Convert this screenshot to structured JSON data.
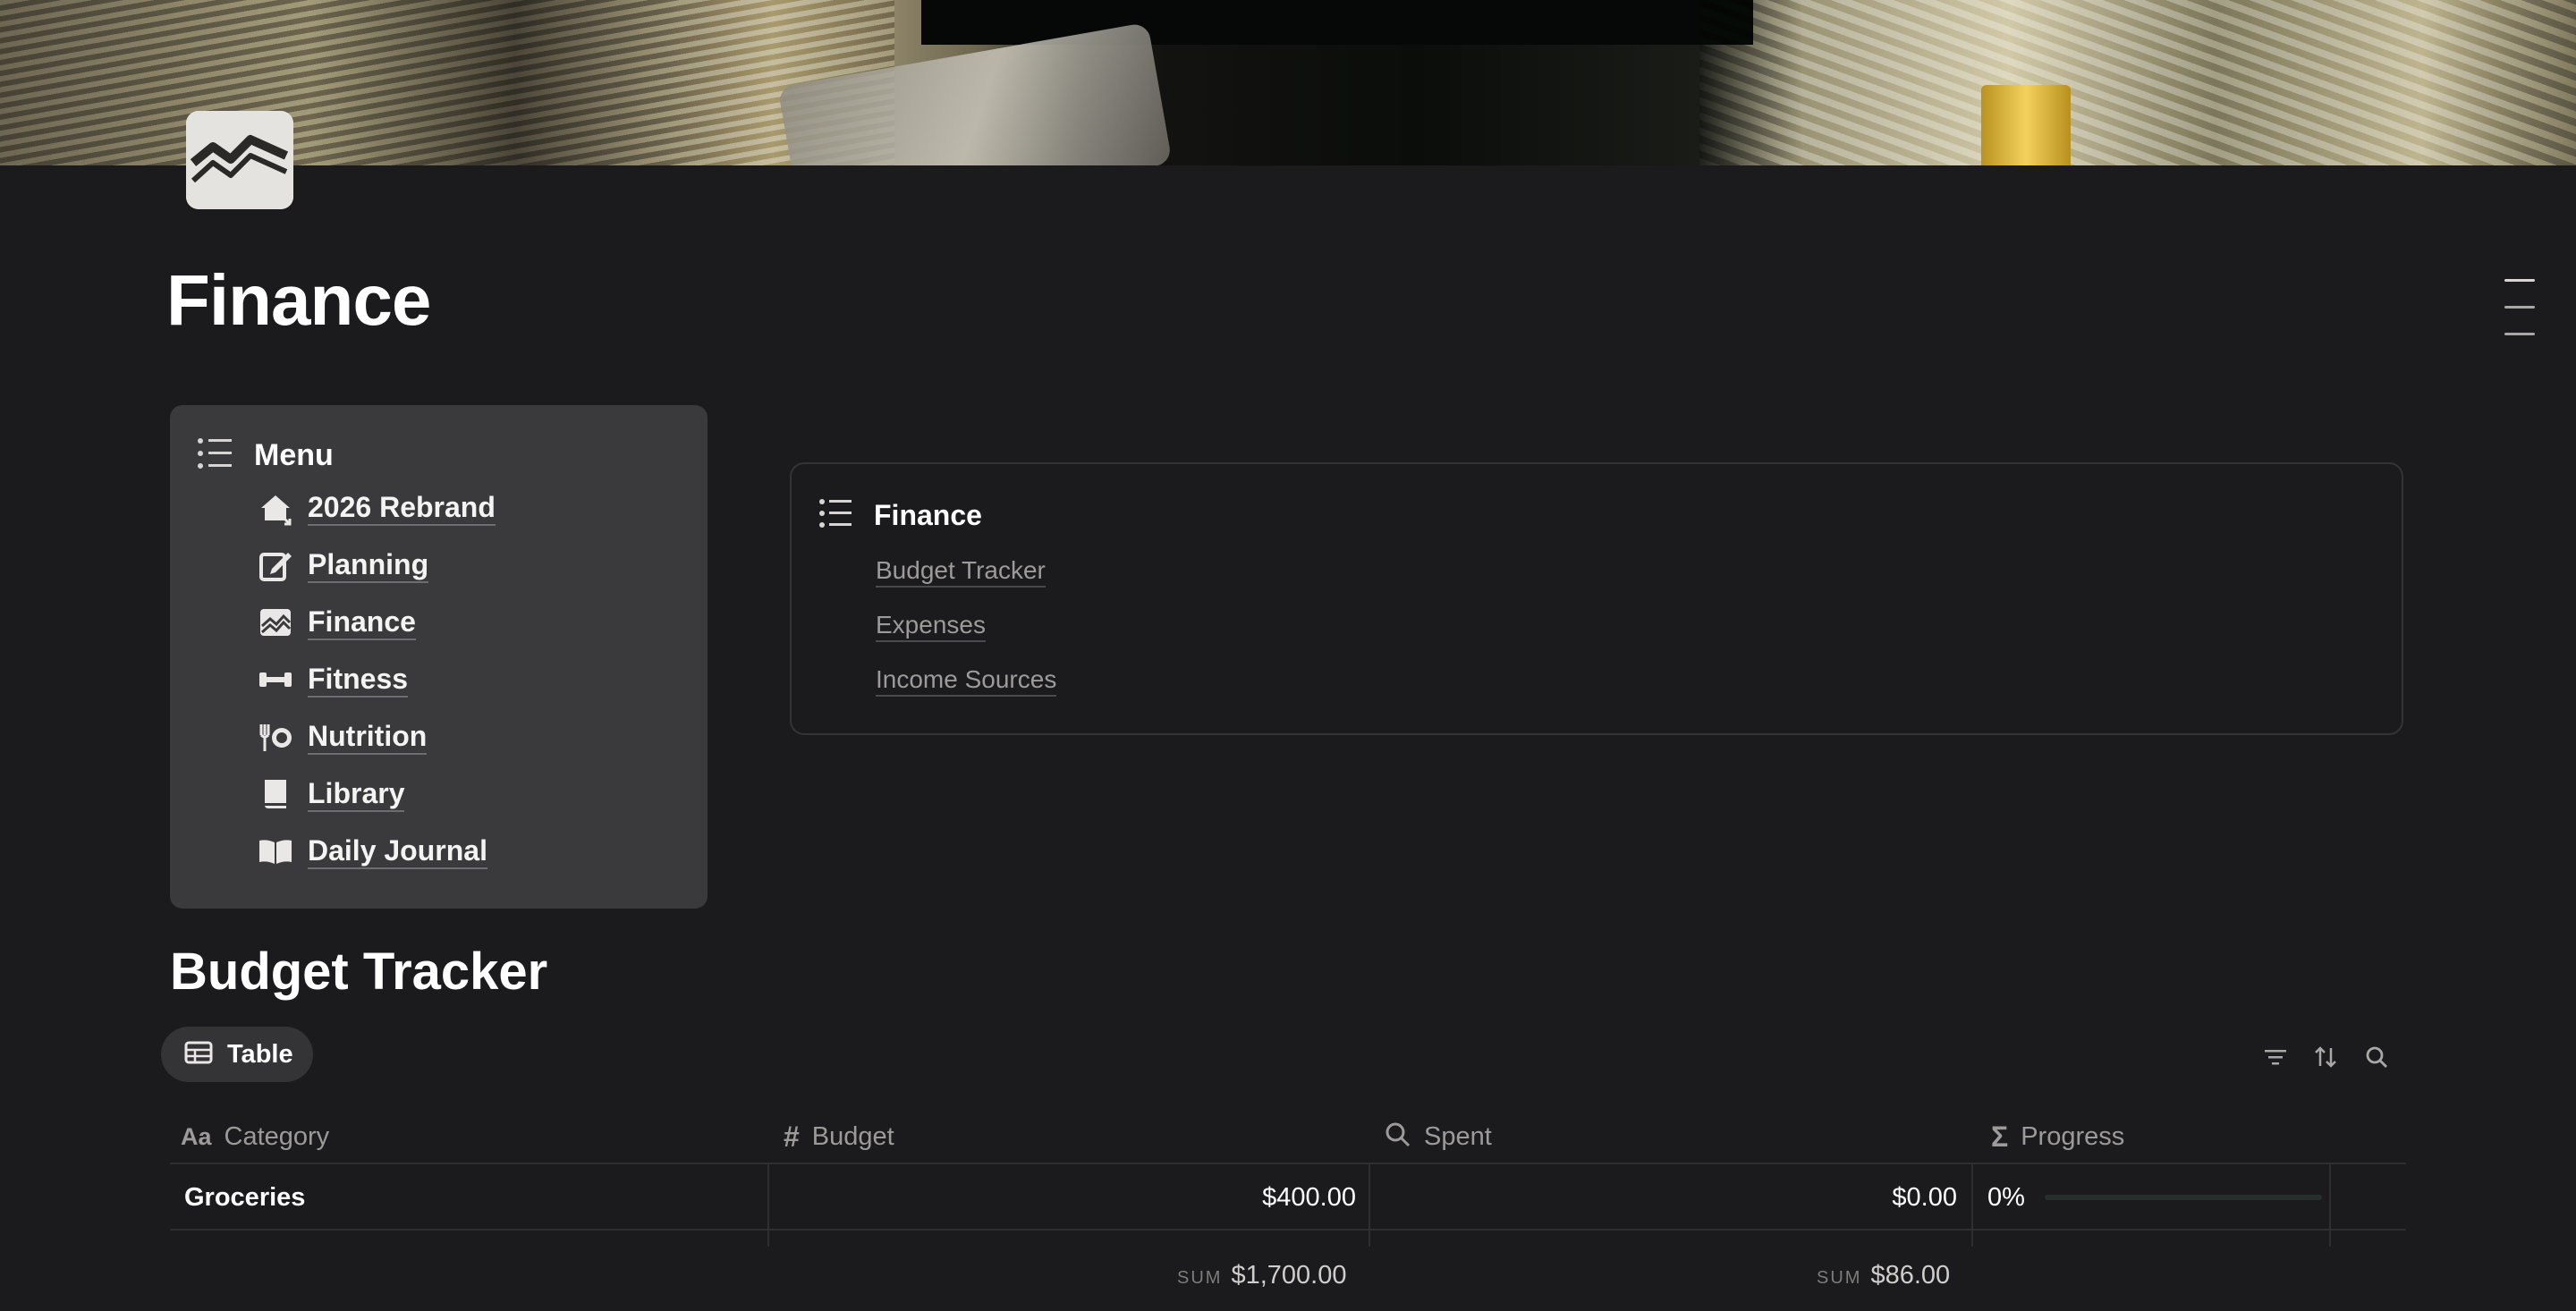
{
  "page": {
    "title": "Finance",
    "icon": "finance-chart-icon"
  },
  "menu": {
    "title": "Menu",
    "items": [
      {
        "label": "2026 Rebrand",
        "icon": "house-icon"
      },
      {
        "label": "Planning",
        "icon": "edit-icon"
      },
      {
        "label": "Finance",
        "icon": "finance-chart-icon"
      },
      {
        "label": "Fitness",
        "icon": "dumbbell-icon"
      },
      {
        "label": "Nutrition",
        "icon": "fork-plate-icon"
      },
      {
        "label": "Library",
        "icon": "book-icon"
      },
      {
        "label": "Daily Journal",
        "icon": "open-book-icon"
      }
    ]
  },
  "finance_links": {
    "title": "Finance",
    "items": [
      "Budget Tracker",
      "Expenses",
      "Income Sources"
    ]
  },
  "budget": {
    "title": "Budget Tracker",
    "view_tab": "Table",
    "columns": [
      {
        "label": "Category",
        "icon": "text-aa-icon"
      },
      {
        "label": "Budget",
        "icon": "hash-icon"
      },
      {
        "label": "Spent",
        "icon": "search-icon"
      },
      {
        "label": "Progress",
        "icon": "sigma-icon"
      }
    ],
    "rows": [
      {
        "category": "Groceries",
        "budget": "$400.00",
        "spent": "$0.00",
        "progress": "0%",
        "progress_value": 0
      }
    ],
    "sums": {
      "label": "SUM",
      "budget": "$1,700.00",
      "spent": "$86.00"
    }
  },
  "colors": {
    "background": "#1b1a1d",
    "card": "#3a393c",
    "muted_text": "#9c9b99",
    "progress": "#3c8a5e"
  }
}
